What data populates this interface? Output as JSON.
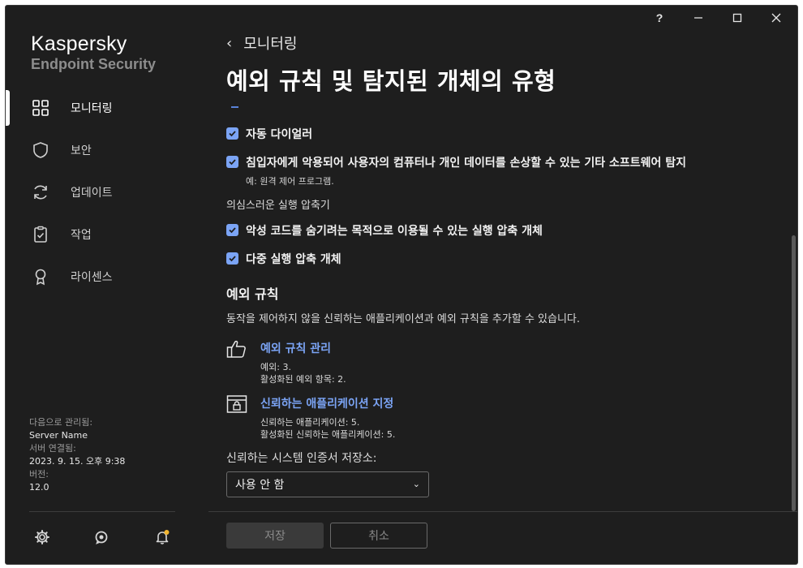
{
  "window": {
    "help_label": "?"
  },
  "sidebar": {
    "brand_line1": "Kaspersky",
    "brand_line2": "Endpoint Security",
    "items": [
      {
        "label": "모니터링",
        "icon": "dashboard-icon",
        "active": true
      },
      {
        "label": "보안",
        "icon": "shield-icon",
        "active": false
      },
      {
        "label": "업데이트",
        "icon": "refresh-icon",
        "active": false
      },
      {
        "label": "작업",
        "icon": "clipboard-check-icon",
        "active": false
      },
      {
        "label": "라이센스",
        "icon": "award-icon",
        "active": false
      }
    ],
    "managed": {
      "managed_by_label": "다음으로 관리됨:",
      "managed_by_value": "Server Name",
      "connection_label": "서버 연결됨:",
      "connection_value": "2023. 9. 15. 오후 9:38",
      "version_label": "버전:",
      "version_value": "12.0"
    }
  },
  "main": {
    "back_label": "모니터링",
    "title": "예외 규칙 및 탐지된 개체의 유형",
    "checks": [
      {
        "label": "자동 다이얼러",
        "checked": true
      },
      {
        "label": "침입자에게 악용되어 사용자의 컴퓨터나 개인 데이터를 손상할 수 있는 기타 소프트웨어 탐지",
        "sub": "예: 원격 제어 프로그램.",
        "checked": true
      }
    ],
    "packers_heading": "의심스러운 실행 압축기",
    "packer_checks": [
      {
        "label": "악성 코드를 숨기려는 목적으로 이용될 수 있는 실행 압축 개체",
        "checked": true
      },
      {
        "label": "다중 실행 압축 개체",
        "checked": true
      }
    ],
    "exclusions": {
      "title": "예외 규칙",
      "description": "동작을 제어하지 않을 신뢰하는 애플리케이션과 예외 규칙을 추가할 수 있습니다.",
      "manage_link": "예외 규칙 관리",
      "manage_line1": "예외: 3.",
      "manage_line2": "활성화된 예외 항목: 2.",
      "trusted_link": "신뢰하는 애플리케이션 지정",
      "trusted_line1": "신뢰하는 애플리케이션: 5.",
      "trusted_line2": "활성화된 신뢰하는 애플리케이션: 5."
    },
    "cert_store_label": "신뢰하는 시스템 인증서 저장소:",
    "cert_store_value": "사용 안 함"
  },
  "footer": {
    "save_label": "저장",
    "cancel_label": "취소"
  },
  "colors": {
    "background": "#1e1e1e",
    "accent": "#7ba4f5",
    "notification_dot": "#f2b630"
  }
}
